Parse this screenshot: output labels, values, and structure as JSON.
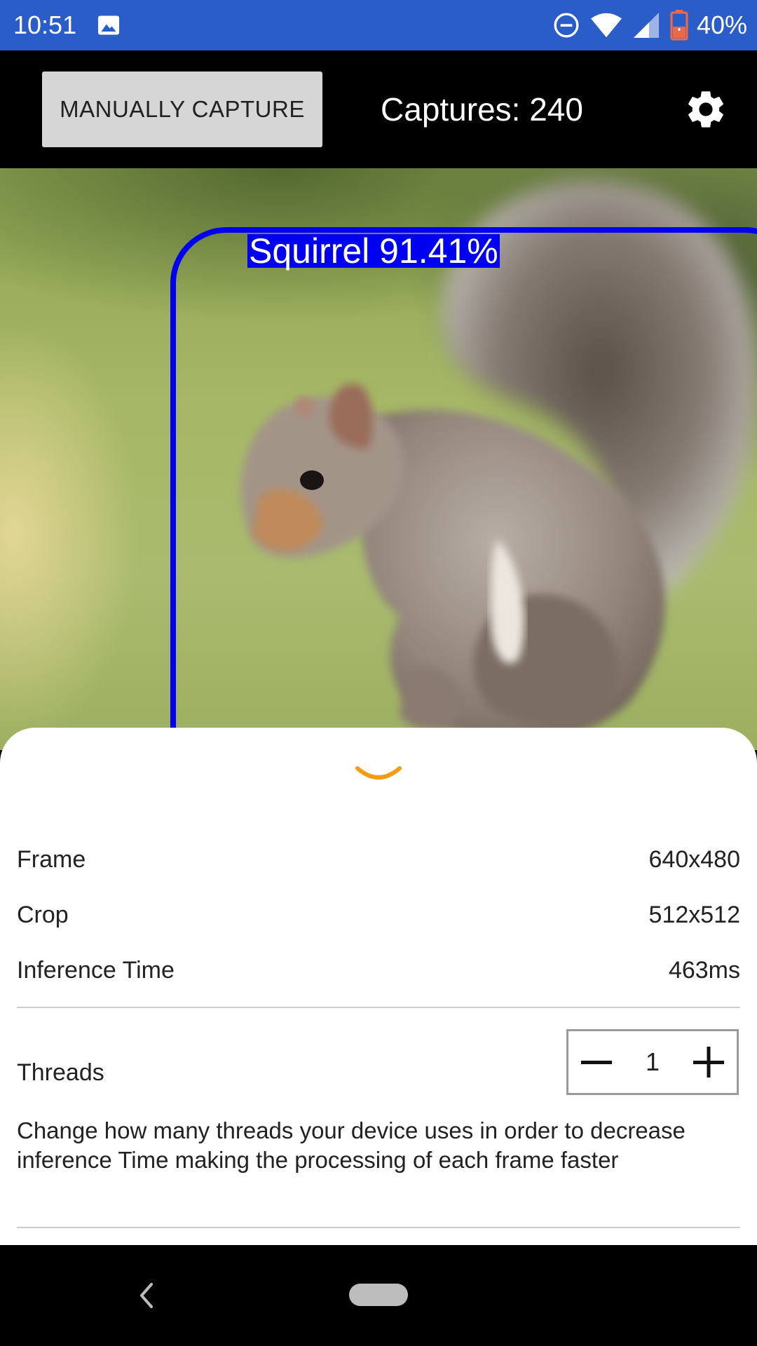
{
  "status_bar": {
    "time": "10:51",
    "battery": "40%",
    "icons": [
      "gallery-icon",
      "do-not-disturb-icon",
      "wifi-icon",
      "signal-icon",
      "battery-icon"
    ]
  },
  "toolbar": {
    "capture_label": "MANUALLY CAPTURE",
    "captures": "Captures: 240",
    "settings_icon": "gear-icon"
  },
  "detection": {
    "label": "Squirrel 91.41%",
    "box_color": "#0000f0"
  },
  "sheet": {
    "handle_icon": "chevron-down-icon",
    "accent_color": "#f39c12",
    "rows": [
      {
        "label": "Frame",
        "value": "640x480"
      },
      {
        "label": "Crop",
        "value": "512x512"
      },
      {
        "label": "Inference Time",
        "value": "463ms"
      }
    ],
    "threads": {
      "label": "Threads",
      "value": "1",
      "description": "Change how many threads your device uses in order to decrease inference Time making the processing of each frame faster"
    }
  },
  "colors": {
    "status_bar": "#2a5dc8",
    "toolbar": "#000000",
    "button_bg": "#d6d6d6"
  }
}
